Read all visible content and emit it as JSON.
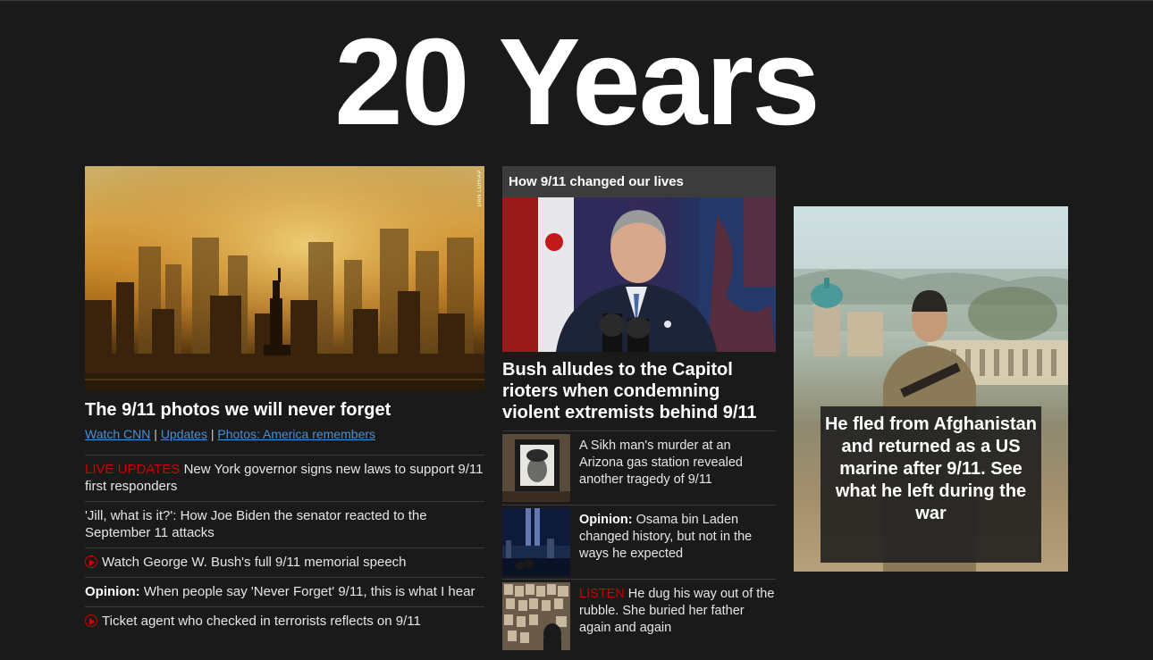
{
  "page": {
    "title": "20 Years"
  },
  "left": {
    "credit": "DAN LOH/AP",
    "headline": "The 9/11 photos we will never forget",
    "links": [
      "Watch CNN",
      "Updates",
      "Photos: America remembers"
    ],
    "separator": "|",
    "items": [
      {
        "prefix": "LIVE UPDATES",
        "text": " New York governor signs new laws to support 9/11 first responders"
      },
      {
        "text": "'Jill, what is it?': How Joe Biden the senator reacted to the September 11 attacks"
      },
      {
        "text": "Watch George W. Bush's full 9/11 memorial speech"
      },
      {
        "prefix": "Opinion:",
        "text": " When people say 'Never Forget' 9/11, this is what I hear"
      },
      {
        "text": "Ticket agent who checked in terrorists reflects on 9/11"
      }
    ]
  },
  "middle": {
    "section_title": "How 9/11 changed our lives",
    "headline": "Bush alludes to the Capitol rioters when condemning violent extremists behind 9/11",
    "items": [
      {
        "text": "A Sikh man's murder at an Arizona gas station revealed another tragedy of 9/11"
      },
      {
        "prefix": "Opinion:",
        "text": " Osama bin Laden changed history, but not in the ways he expected"
      },
      {
        "prefix": "LISTEN",
        "text": " He dug his way out of the rubble. She buried her father again and again"
      }
    ]
  },
  "right": {
    "overlay_text": "He fled from Afghanistan and returned as a US marine after 9/11. See what he left during the war"
  },
  "colors": {
    "background": "#1a1a1a",
    "accent_red": "#cc0000",
    "link_blue": "#4a8fd4",
    "section_bg": "#3c3c3c"
  }
}
